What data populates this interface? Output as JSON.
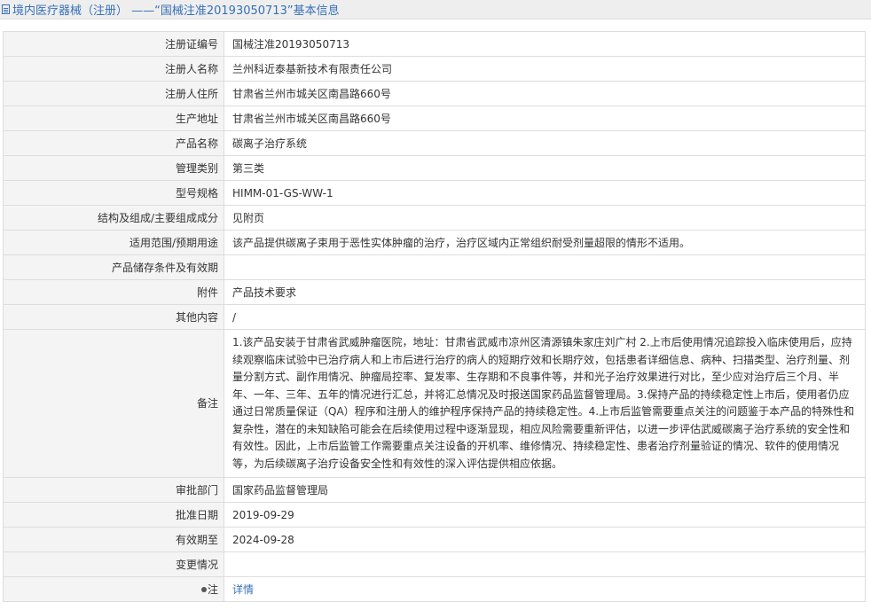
{
  "header": {
    "title": "境内医疗器械（注册） ——“国械注准20193050713”基本信息"
  },
  "rows": [
    {
      "label": "注册证编号",
      "value": "国械注准20193050713"
    },
    {
      "label": "注册人名称",
      "value": "兰州科近泰基新技术有限责任公司"
    },
    {
      "label": "注册人住所",
      "value": "甘肃省兰州市城关区南昌路660号"
    },
    {
      "label": "生产地址",
      "value": "甘肃省兰州市城关区南昌路660号"
    },
    {
      "label": "产品名称",
      "value": "碳离子治疗系统"
    },
    {
      "label": "管理类别",
      "value": "第三类"
    },
    {
      "label": "型号规格",
      "value": "HIMM-01-GS-WW-1"
    },
    {
      "label": "结构及组成/主要组成成分",
      "value": "见附页"
    },
    {
      "label": "适用范围/预期用途",
      "value": "该产品提供碳离子束用于恶性实体肿瘤的治疗，治疗区域内正常组织耐受剂量超限的情形不适用。"
    },
    {
      "label": "产品储存条件及有效期",
      "value": ""
    },
    {
      "label": "附件",
      "value": "产品技术要求"
    },
    {
      "label": "其他内容",
      "value": "/"
    },
    {
      "label": "备注",
      "value": "1.该产品安装于甘肃省武威肿瘤医院，地址：甘肃省武威市凉州区清源镇朱家庄刘广村 2.上市后使用情况追踪投入临床使用后，应持续观察临床试验中已治疗病人和上市后进行治疗的病人的短期疗效和长期疗效，包括患者详细信息、病种、扫描类型、治疗剂量、剂量分割方式、副作用情况、肿瘤局控率、复发率、生存期和不良事件等，并和光子治疗效果进行对比，至少应对治疗后三个月、半年、一年、三年、五年的情况进行汇总，并将汇总情况及时报送国家药品监督管理局。3.保持产品的持续稳定性上市后，使用者仍应通过日常质量保证（QA）程序和注册人的维护程序保持产品的持续稳定性。4.上市后监管需要重点关注的问题鉴于本产品的特殊性和复杂性，潜在的未知缺陷可能会在后续使用过程中逐渐显现，相应风险需要重新评估，以进一步评估武威碳离子治疗系统的安全性和有效性。因此，上市后监管工作需要重点关注设备的开机率、维修情况、持续稳定性、患者治疗剂量验证的情况、软件的使用情况等，为后续碳离子治疗设备安全性和有效性的深入评估提供相应依据。"
    },
    {
      "label": "审批部门",
      "value": "国家药品监督管理局"
    },
    {
      "label": "批准日期",
      "value": "2019-09-29"
    },
    {
      "label": "有效期至",
      "value": "2024-09-28"
    },
    {
      "label": "变更情况",
      "value": ""
    }
  ],
  "note_row": {
    "label": "注",
    "link_text": "详情",
    "icon": "pin-icon"
  },
  "colors": {
    "link": "#3671b8",
    "label_bg": "#f4f4f4",
    "border": "#dddddd"
  }
}
